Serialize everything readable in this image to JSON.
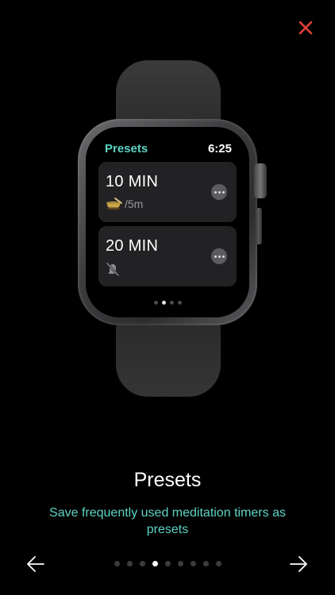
{
  "watch_screen": {
    "title": "Presets",
    "time": "6:25",
    "presets": [
      {
        "name": "10 MIN",
        "sound_icon": "singing-bowl-icon",
        "interval": "/5m"
      },
      {
        "name": "20 MIN",
        "sound_icon": "bell-muted-icon",
        "interval": ""
      }
    ],
    "page_count": 4,
    "active_page": 1
  },
  "onboarding": {
    "title": "Presets",
    "subtitle": "Save frequently used meditation timers as presets",
    "page_count": 9,
    "active_page": 3
  },
  "icons": {
    "close": "close-icon",
    "prev": "arrow-left-icon",
    "next": "arrow-right-icon"
  },
  "colors": {
    "accent": "#5ed3c3",
    "close": "#e0413a",
    "background": "#000000"
  }
}
